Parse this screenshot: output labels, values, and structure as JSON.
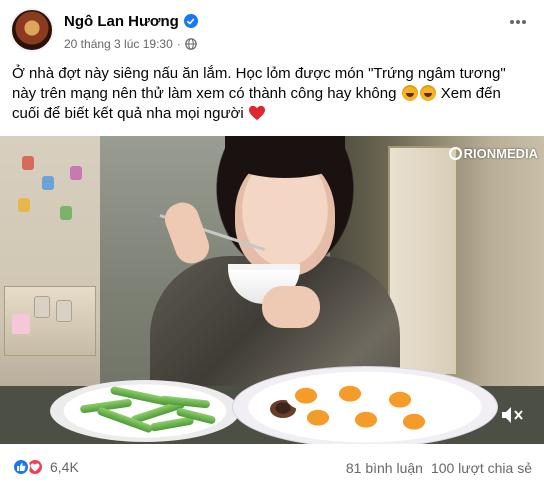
{
  "post": {
    "author": "Ngô Lan Hương",
    "timestamp": "20 tháng 3 lúc 19:30",
    "separator": "·",
    "privacy_icon": "globe-icon",
    "verified_icon": "verified-badge-icon",
    "more_icon": "more-options-icon",
    "caption": {
      "part1": "Ở nhà đợt này siêng nấu ăn lắm. Học lỏm được món \"Trứng ngâm tương\" này trên mạng nên thử làm xem có thành công hay không ",
      "part2": " Xem đến cuối để biết kết quả nha mọi người "
    }
  },
  "video": {
    "watermark": "RIONMEDIA",
    "mute_icon": "muted-speaker-icon"
  },
  "footer": {
    "reaction_count": "6,4K",
    "comments": "81 bình luận",
    "shares": "100 lượt chia sẻ"
  },
  "colors": {
    "accent": "#1877f2",
    "love": "#f33e58",
    "muted_text": "#65676b"
  }
}
